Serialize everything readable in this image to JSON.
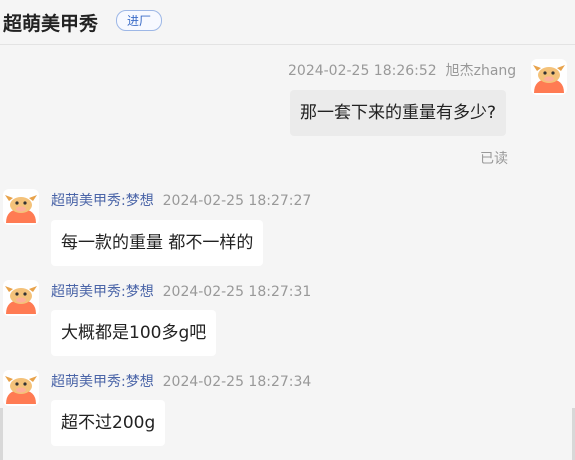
{
  "header": {
    "title": "超萌美甲秀",
    "badge": "进厂"
  },
  "messages": [
    {
      "timestamp": "2024-02-25 18:26:52",
      "sender": "旭杰zhang",
      "text": "那一套下来的重量有多少?",
      "status": "已读"
    },
    {
      "sender": "超萌美甲秀:梦想",
      "timestamp": "2024-02-25 18:27:27",
      "text": "每一款的重量 都不一样的"
    },
    {
      "sender": "超萌美甲秀:梦想",
      "timestamp": "2024-02-25 18:27:31",
      "text": "大概都是100多g吧"
    },
    {
      "sender": "超萌美甲秀:梦想",
      "timestamp": "2024-02-25 18:27:34",
      "text": "超不过200g"
    }
  ],
  "colors": {
    "sender_name": "#4b65a8",
    "avatar": "#ff7b53",
    "self_bubble": "#ebebeb",
    "other_bubble": "#ffffff"
  },
  "icons": {
    "avatar": "cartoon-cow-avatar-icon"
  }
}
